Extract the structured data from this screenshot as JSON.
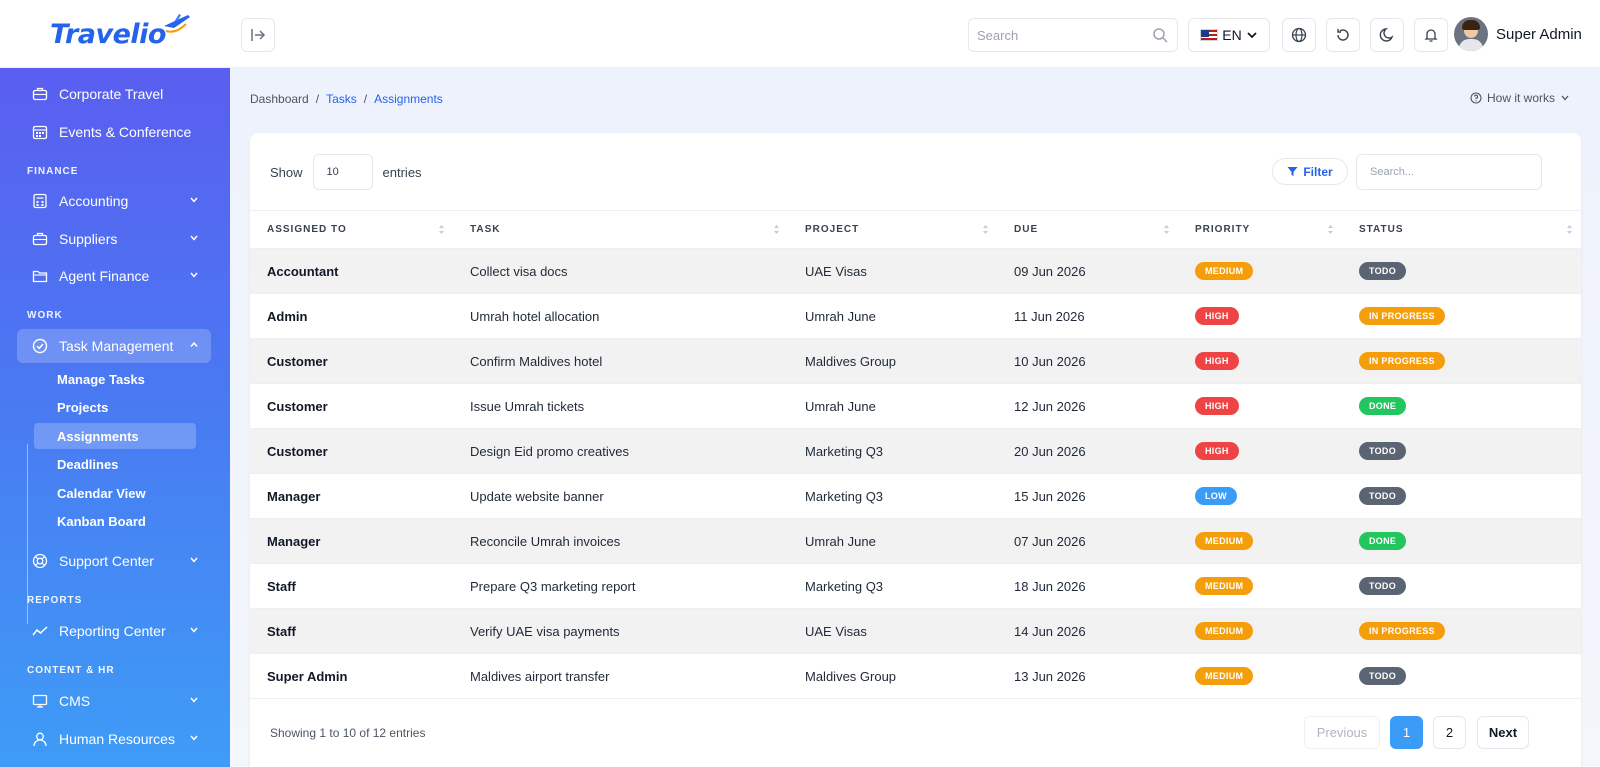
{
  "app": {
    "logo_text": "Travelio"
  },
  "header": {
    "search_placeholder": "Search",
    "language": "EN",
    "user_name": "Super Admin"
  },
  "sidebar": {
    "top_items": [
      {
        "label": "Corporate Travel",
        "icon": "briefcase-icon"
      },
      {
        "label": "Events & Conference",
        "icon": "calendar-icon"
      }
    ],
    "sections": {
      "finance": "FINANCE",
      "work": "WORK",
      "reports": "REPORTS",
      "content_hr": "CONTENT & HR"
    },
    "finance_items": [
      {
        "label": "Accounting",
        "icon": "calculator-icon"
      },
      {
        "label": "Suppliers",
        "icon": "briefcase-icon"
      },
      {
        "label": "Agent Finance",
        "icon": "folder-icon"
      }
    ],
    "task_management": {
      "label": "Task Management",
      "icon": "check-circle-icon"
    },
    "task_submenu": [
      "Manage Tasks",
      "Projects",
      "Assignments",
      "Deadlines",
      "Calendar View",
      "Kanban Board"
    ],
    "support_center": {
      "label": "Support Center",
      "icon": "lifebuoy-icon"
    },
    "reporting_center": {
      "label": "Reporting Center",
      "icon": "trend-line-icon"
    },
    "cms": {
      "label": "CMS",
      "icon": "monitor-icon"
    },
    "human_resources": {
      "label": "Human Resources",
      "icon": "user-icon"
    }
  },
  "breadcrumb": {
    "home": "Dashboard",
    "sep": "/",
    "parent": "Tasks",
    "current": "Assignments"
  },
  "how_it_works": "How it works",
  "table_controls": {
    "show_label": "Show",
    "entries_value": "10",
    "entries_label": "entries",
    "filter_label": "Filter",
    "search_placeholder": "Search..."
  },
  "table": {
    "headers": [
      "ASSIGNED TO",
      "TASK",
      "PROJECT",
      "DUE",
      "PRIORITY",
      "STATUS"
    ],
    "rows": [
      {
        "assigned_to": "Accountant",
        "task": "Collect visa docs",
        "project": "UAE Visas",
        "due": "09 Jun 2026",
        "priority": "MEDIUM",
        "status": "TODO"
      },
      {
        "assigned_to": "Admin",
        "task": "Umrah hotel allocation",
        "project": "Umrah June",
        "due": "11 Jun 2026",
        "priority": "HIGH",
        "status": "IN PROGRESS"
      },
      {
        "assigned_to": "Customer",
        "task": "Confirm Maldives hotel",
        "project": "Maldives Group",
        "due": "10 Jun 2026",
        "priority": "HIGH",
        "status": "IN PROGRESS"
      },
      {
        "assigned_to": "Customer",
        "task": "Issue Umrah tickets",
        "project": "Umrah June",
        "due": "12 Jun 2026",
        "priority": "HIGH",
        "status": "DONE"
      },
      {
        "assigned_to": "Customer",
        "task": "Design Eid promo creatives",
        "project": "Marketing Q3",
        "due": "20 Jun 2026",
        "priority": "HIGH",
        "status": "TODO"
      },
      {
        "assigned_to": "Manager",
        "task": "Update website banner",
        "project": "Marketing Q3",
        "due": "15 Jun 2026",
        "priority": "LOW",
        "status": "TODO"
      },
      {
        "assigned_to": "Manager",
        "task": "Reconcile Umrah invoices",
        "project": "Umrah June",
        "due": "07 Jun 2026",
        "priority": "MEDIUM",
        "status": "DONE"
      },
      {
        "assigned_to": "Staff",
        "task": "Prepare Q3 marketing report",
        "project": "Marketing Q3",
        "due": "18 Jun 2026",
        "priority": "MEDIUM",
        "status": "TODO"
      },
      {
        "assigned_to": "Staff",
        "task": "Verify UAE visa payments",
        "project": "UAE Visas",
        "due": "14 Jun 2026",
        "priority": "MEDIUM",
        "status": "IN PROGRESS"
      },
      {
        "assigned_to": "Super Admin",
        "task": "Maldives airport transfer",
        "project": "Maldives Group",
        "due": "13 Jun 2026",
        "priority": "MEDIUM",
        "status": "TODO"
      }
    ]
  },
  "badge_colors": {
    "MEDIUM": "#f59e0b",
    "HIGH": "#ef4444",
    "LOW": "#3b9cf7",
    "TODO": "#5b6472",
    "IN PROGRESS": "#f59e0b",
    "DONE": "#22c55e"
  },
  "pagination": {
    "info": "Showing 1 to 10 of 12 entries",
    "previous": "Previous",
    "pages": [
      "1",
      "2"
    ],
    "next": "Next"
  },
  "colors": {
    "accent": "#2563eb",
    "sidebar_top": "#5a5ef0",
    "sidebar_bottom": "#3e9cf6"
  }
}
